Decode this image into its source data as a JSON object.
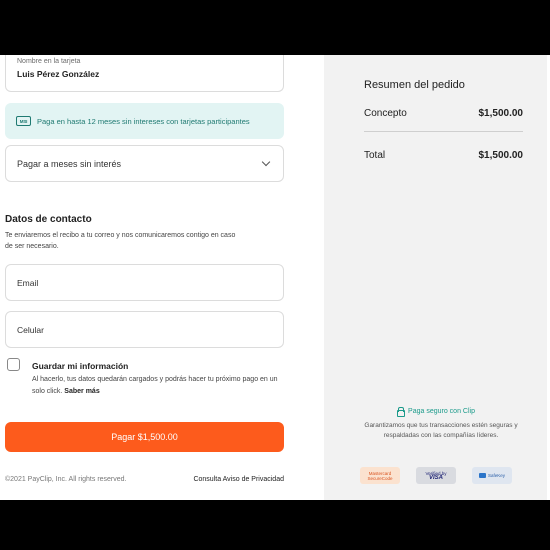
{
  "card": {
    "name_label": "Nombre en la tarjeta",
    "name_value": "Luis Pérez González"
  },
  "msi_banner": {
    "icon_text": "MSI",
    "text": "Paga en hasta 12 meses sin intereses con tarjetas participantes"
  },
  "msi_select": {
    "value": "Pagar a meses sin interés",
    "icon": "chevron-down-icon"
  },
  "contact": {
    "title": "Datos de contacto",
    "description": "Te enviaremos el recibo a tu correo y nos comunicaremos contigo en caso de ser necesario.",
    "email_placeholder": "Email",
    "phone_placeholder": "Celular"
  },
  "save_info": {
    "title": "Guardar mi información",
    "description": "Al hacerlo, tus datos quedarán cargados y podrás hacer tu próximo pago en un solo click.",
    "link": "Saber más"
  },
  "pay_button": "Pagar $1,500.00",
  "footer": {
    "copyright": "©2021 PayClip, Inc. All rights reserved.",
    "privacy_link": "Consulta Aviso de Privacidad"
  },
  "summary": {
    "title": "Resumen del pedido",
    "concept_label": "Concepto",
    "concept_amount": "$1,500.00",
    "total_label": "Total",
    "total_amount": "$1,500.00"
  },
  "security": {
    "title": "Paga seguro con Clip",
    "description": "Garantizamos que tus transacciones estén seguras y respaldadas con las compañías líderes.",
    "badges": {
      "mastercard_line1": "Mastercard",
      "mastercard_line2": "SecureCode",
      "visa_line1": "Verified by",
      "visa_line2": "VISA",
      "amex": "SafeKey"
    }
  },
  "colors": {
    "accent": "#fd5b1c",
    "teal": "#1f7a72",
    "banner_bg": "#e2f4f3",
    "summary_bg": "#f2f2f2"
  }
}
